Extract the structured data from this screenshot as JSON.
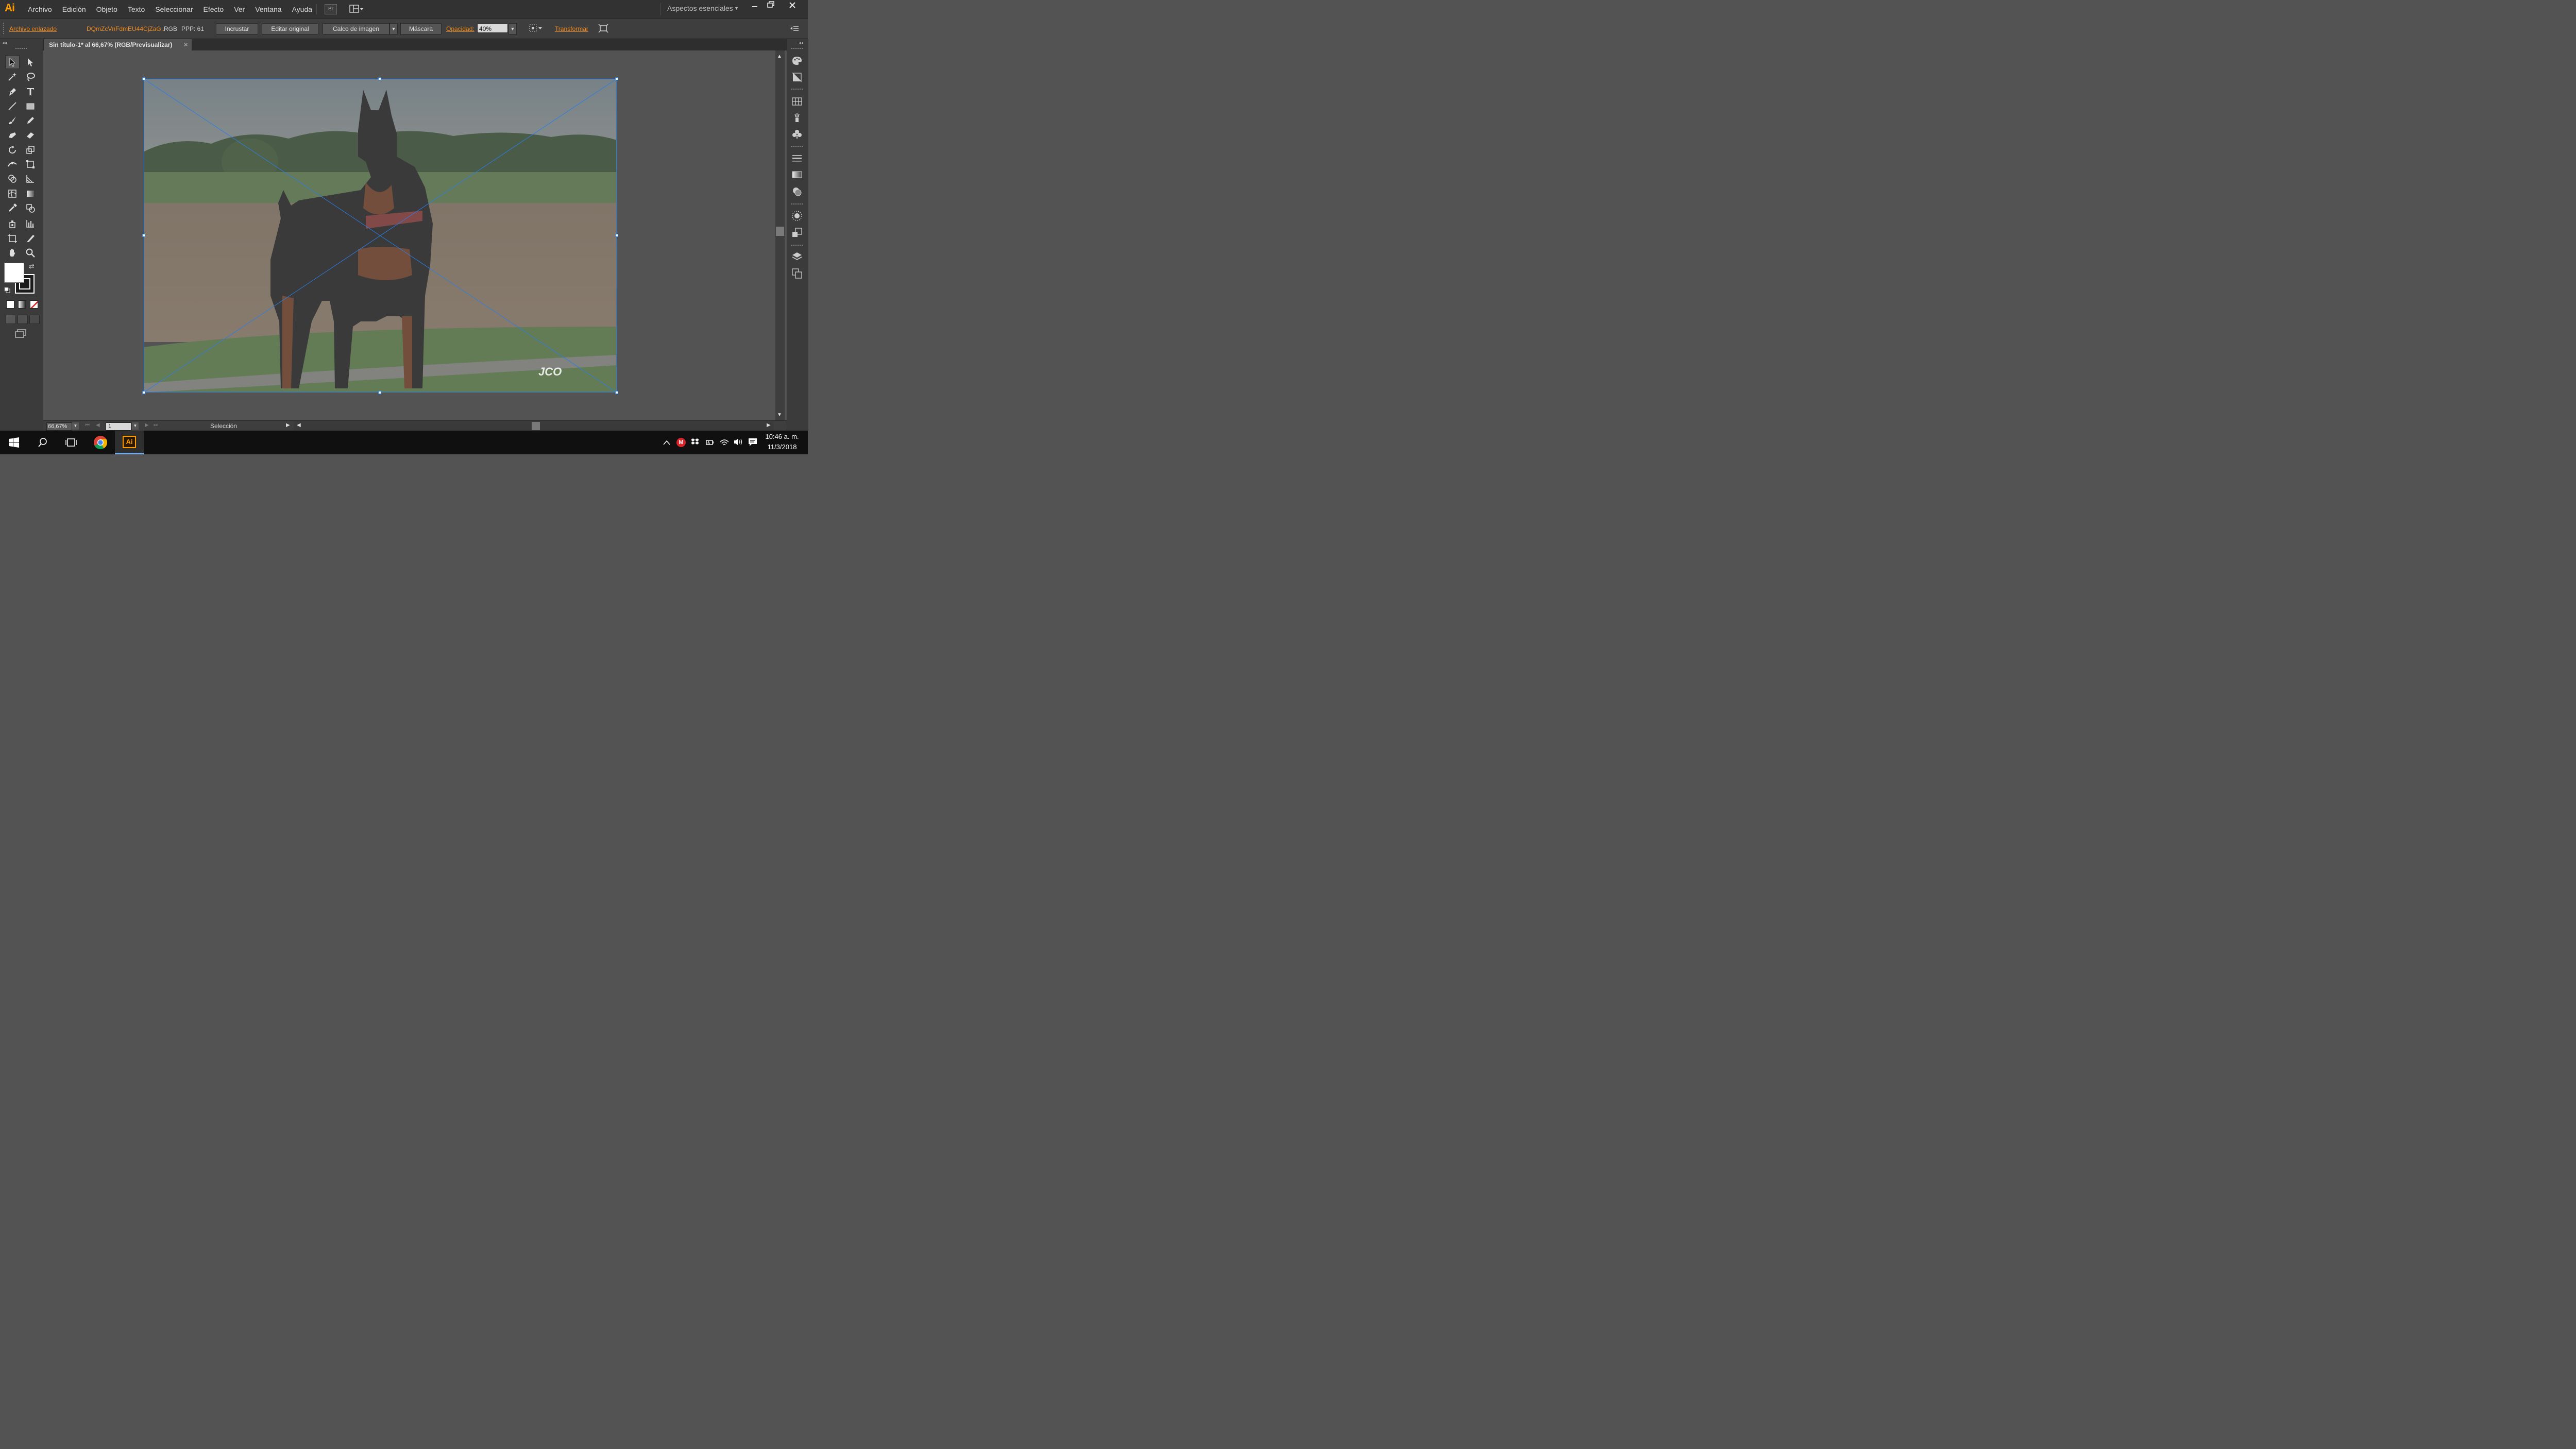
{
  "app": {
    "logo": "Ai",
    "menu": [
      "Archivo",
      "Edición",
      "Objeto",
      "Texto",
      "Seleccionar",
      "Efecto",
      "Ver",
      "Ventana",
      "Ayuda"
    ],
    "bridge_label": "Br",
    "workspace": "Aspectos esenciales"
  },
  "control_bar": {
    "linked_file": "Archivo enlazado",
    "file_name": "DQmZcVnFdmEU44CjZaG..",
    "color_mode": "RGB",
    "ppi": "PPP: 61",
    "embed": "Incrustar",
    "edit_original": "Editar original",
    "image_trace": "Calco de imagen",
    "mask": "Máscara",
    "opacity_label": "Opacidad:",
    "opacity_value": "40%",
    "transform": "Transformar"
  },
  "document": {
    "tab_title": "Sin título-1* al 66,67% (RGB/Previsualizar)",
    "close_glyph": "×",
    "watermark": "JCO"
  },
  "status_bar": {
    "zoom": "66,67%",
    "artboard": "1",
    "tool_status": "Selección"
  },
  "taskbar": {
    "time": "10:46 a. m.",
    "date": "11/3/2018",
    "ai_label": "Ai"
  },
  "colors": {
    "accent_orange": "#f08a1c",
    "selection_blue": "#2a7de8",
    "ui_dark": "#323232",
    "canvas_gray": "#535353"
  }
}
